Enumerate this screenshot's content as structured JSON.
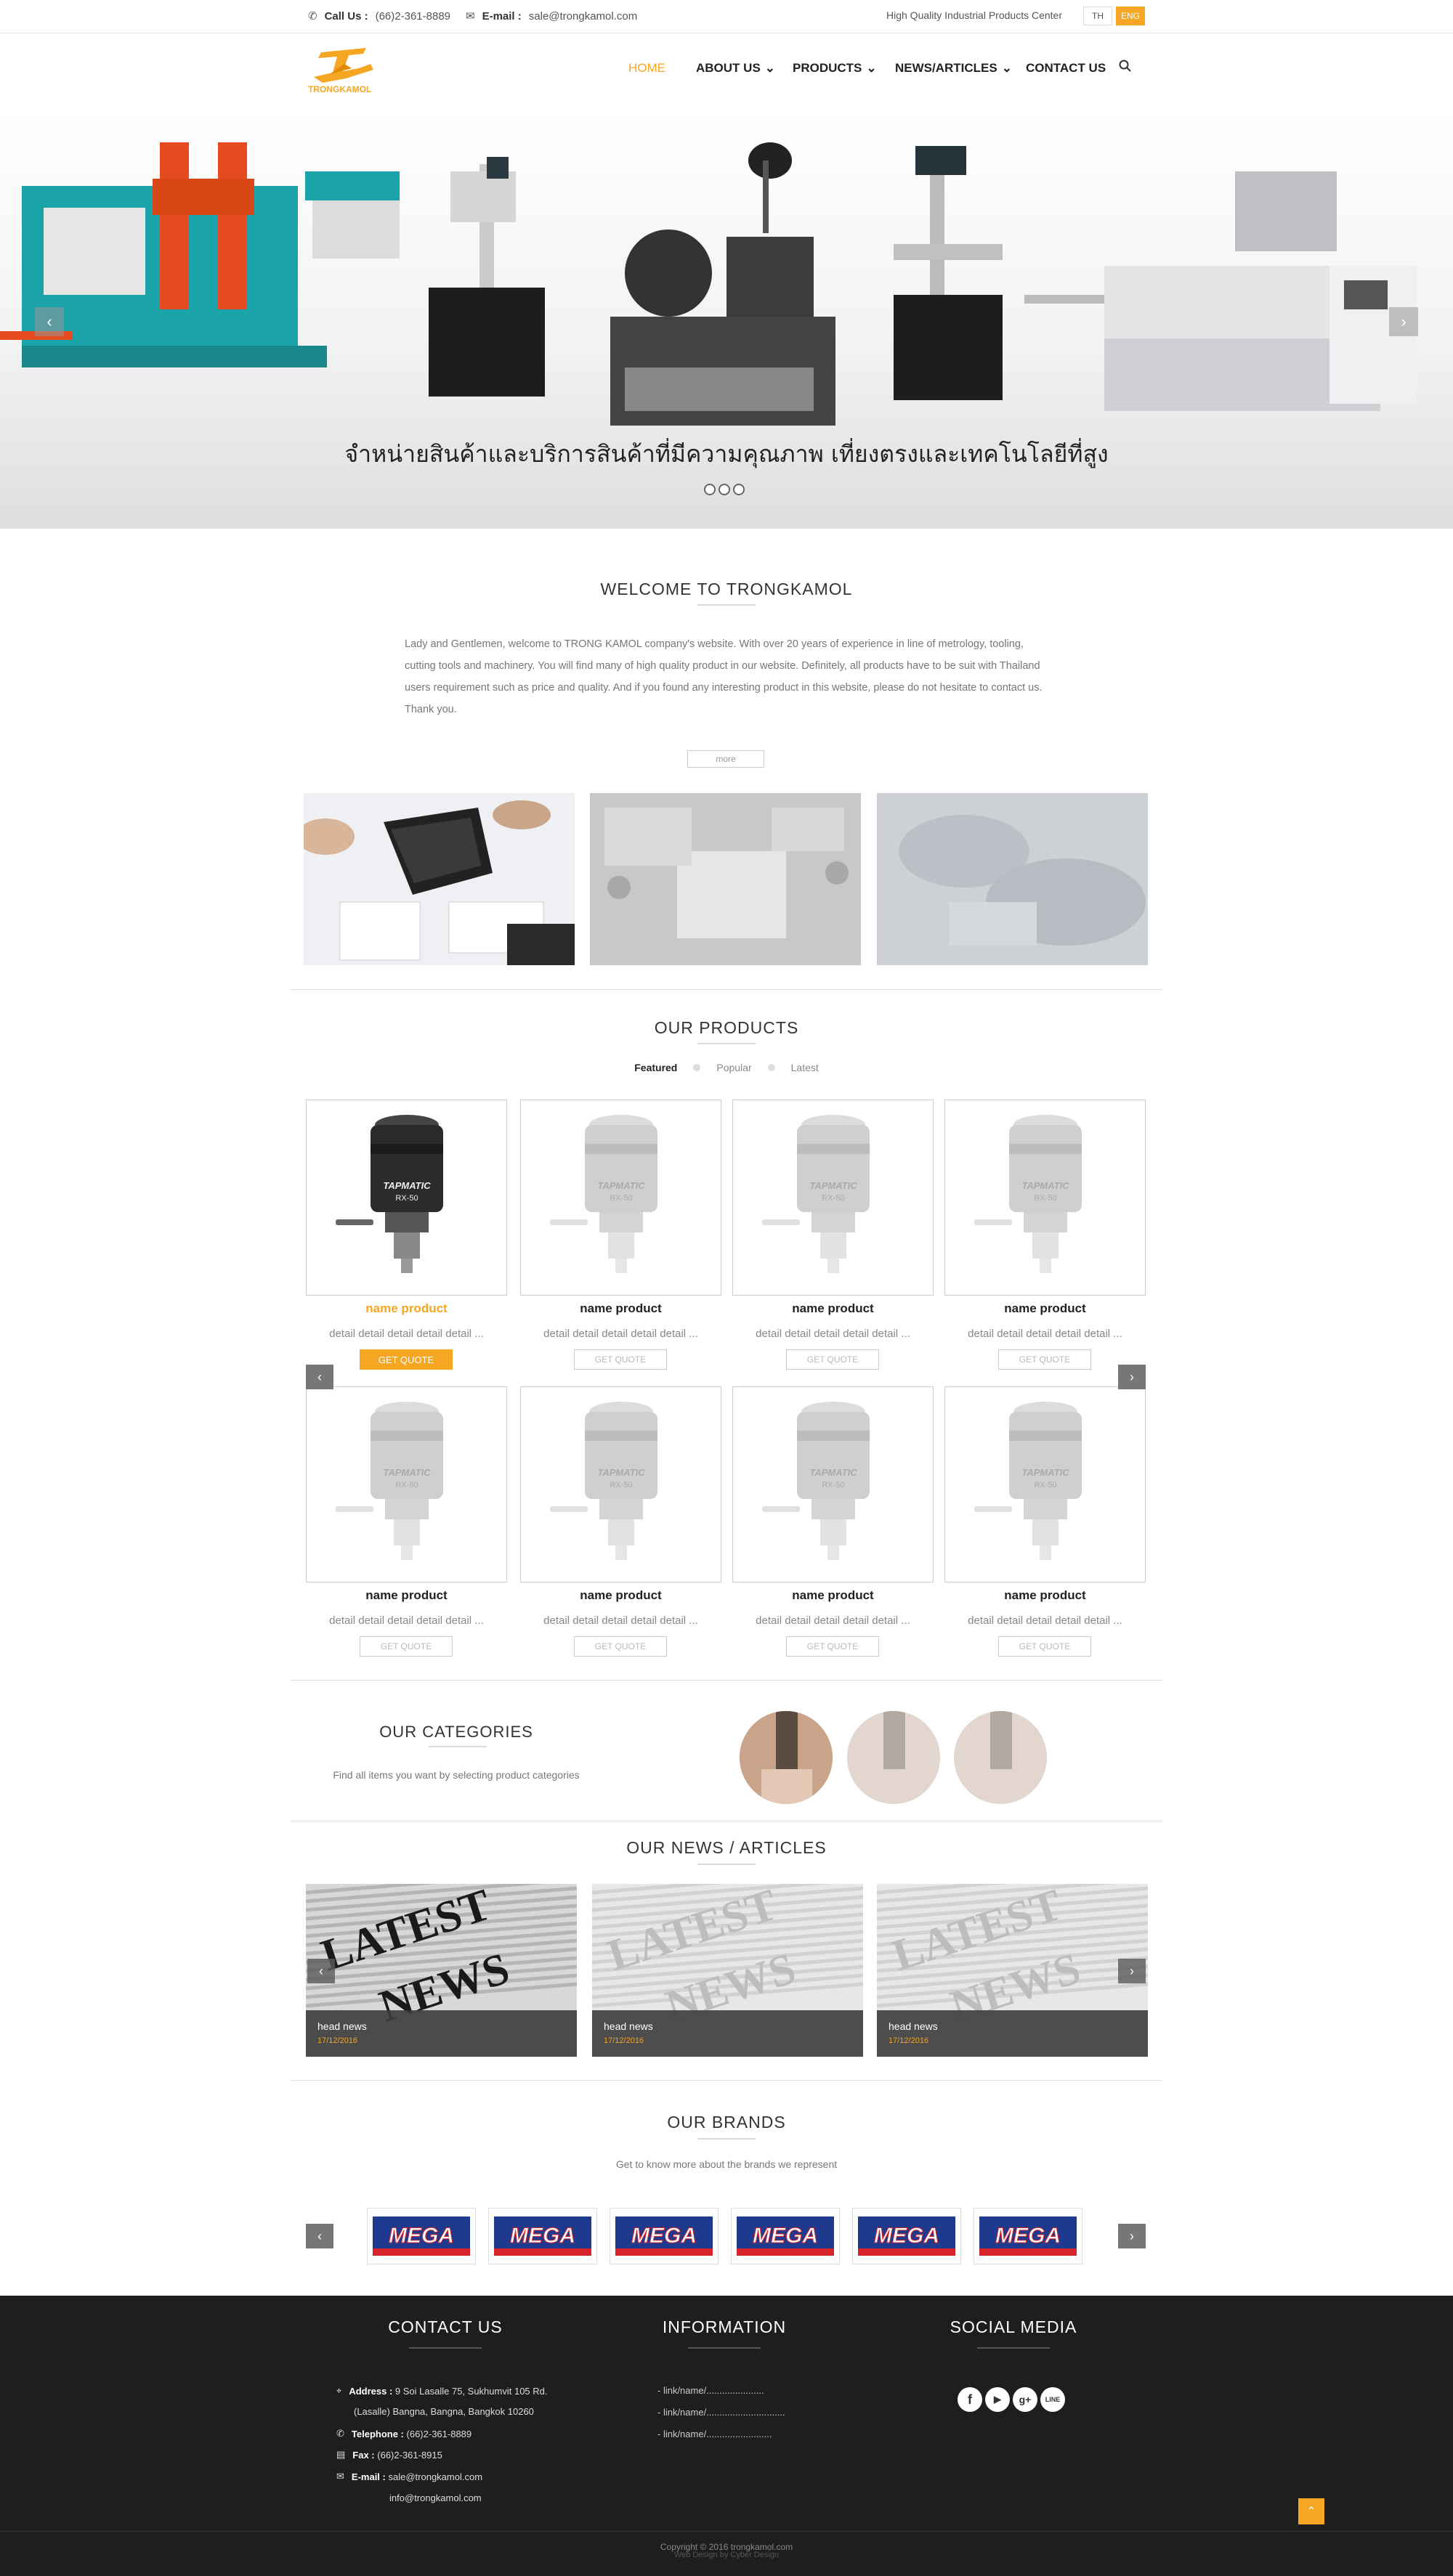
{
  "topbar": {
    "call_label": "Call Us :",
    "call_value": "(66)2-361-8889",
    "email_label": "E-mail :",
    "email_value": "sale@trongkamol.com",
    "tagline": "High Quality Industrial Products Center",
    "lang_th": "TH",
    "lang_eng": "ENG"
  },
  "brand": {
    "logo_text": "TRONGKAMOL",
    "accent": "#f5a623"
  },
  "nav": {
    "home": "HOME",
    "about": "ABOUT US",
    "products": "PRODUCTS",
    "news": "NEWS/ARTICLES",
    "contact": "CONTACT US"
  },
  "hero": {
    "caption": "จำหน่ายสินค้าและบริการสินค้าที่มีความคุณภาพ เที่ยงตรงและเทคโนโลยีที่สูง",
    "prev": "‹",
    "next": "›"
  },
  "welcome": {
    "title": "WELCOME TO TRONGKAMOL",
    "text": "Lady and Gentlemen, welcome to TRONG KAMOL company's website. With over 20 years of experience in line of metrology, tooling, cutting tools and machinery. You will find many of high quality product in our website. Definitely, all products have to be suit with Thailand users requirement such as price and quality. And if you found any interesting product in this website, please do not hesitate to contact us. Thank you.",
    "more": "more"
  },
  "products": {
    "title": "OUR PRODUCTS",
    "tab_featured": "Featured",
    "tab_popular": "Popular",
    "tab_latest": "Latest",
    "items": [
      {
        "name": "name product",
        "detail": "detail detail detail detail detail ...",
        "quote": "GET QUOTE"
      },
      {
        "name": "name product",
        "detail": "detail detail detail detail detail ...",
        "quote": "GET QUOTE"
      },
      {
        "name": "name product",
        "detail": "detail detail detail detail detail ...",
        "quote": "GET QUOTE"
      },
      {
        "name": "name product",
        "detail": "detail detail detail detail detail ...",
        "quote": "GET QUOTE"
      },
      {
        "name": "name product",
        "detail": "detail detail detail detail detail ...",
        "quote": "GET QUOTE"
      },
      {
        "name": "name product",
        "detail": "detail detail detail detail detail ...",
        "quote": "GET QUOTE"
      },
      {
        "name": "name product",
        "detail": "detail detail detail detail detail ...",
        "quote": "GET QUOTE"
      },
      {
        "name": "name product",
        "detail": "detail detail detail detail detail ...",
        "quote": "GET QUOTE"
      }
    ],
    "product_brand": "TAPMATIC",
    "product_model": "RX-50"
  },
  "categories": {
    "title": "OUR CATEGORIES",
    "text": "Find all items you want by selecting product categories"
  },
  "news": {
    "title": "OUR NEWS / ARTICLES",
    "image_text_1": "LATEST",
    "image_text_2": "NEWS",
    "items": [
      {
        "head": "head news",
        "date": "17/12/2016"
      },
      {
        "head": "head news",
        "date": "17/12/2016"
      },
      {
        "head": "head news",
        "date": "17/12/2016"
      }
    ]
  },
  "brands": {
    "title": "OUR BRANDS",
    "text": "Get to know more about the brands we represent",
    "logo": "MEGA"
  },
  "footer": {
    "contact_title": "CONTACT US",
    "address_label": "Address :",
    "address_1": "9 Soi Lasalle 75, Sukhumvit 105 Rd.",
    "address_2": "(Lasalle) Bangna, Bangna, Bangkok 10260",
    "tel_label": "Telephone :",
    "tel": "(66)2-361-8889",
    "fax_label": "Fax :",
    "fax": "(66)2-361-8915",
    "email_label": "E-mail :",
    "email_1": "sale@trongkamol.com",
    "email_2": "info@trongkamol.com",
    "info_title": "INFORMATION",
    "links": [
      "- link/name/......................",
      "- link/name/..............................",
      "- link/name/........................."
    ],
    "social_title": "SOCIAL MEDIA",
    "social": [
      "f",
      "▶",
      "g+",
      "LINE"
    ],
    "copyright": "Copyright © 2016 trongkamol.com",
    "credit": "Web Design by Cyber Design"
  }
}
